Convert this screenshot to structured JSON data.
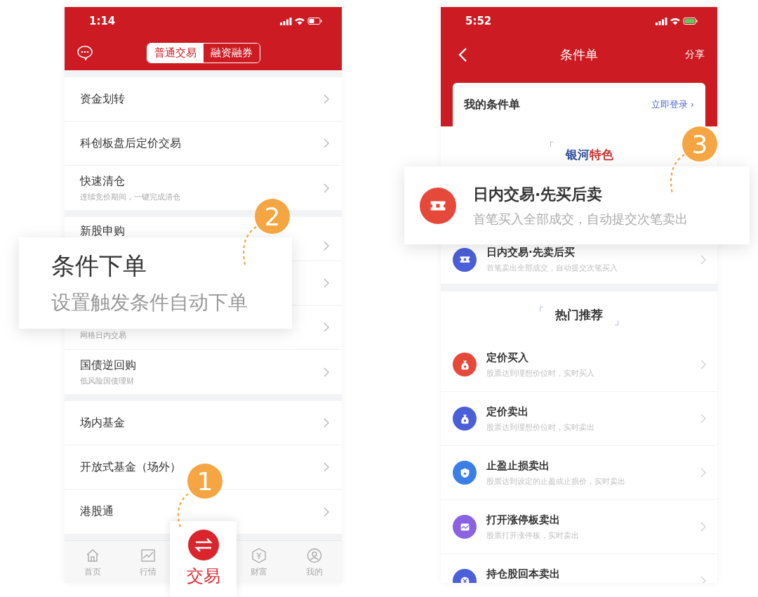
{
  "left_screen": {
    "status_bar": {
      "time": "1:14"
    },
    "segmented_tabs": [
      {
        "label": "普通交易",
        "selected": true
      },
      {
        "label": "融资融券",
        "selected": false
      }
    ],
    "groups": [
      {
        "rows": [
          {
            "title": "资金划转"
          },
          {
            "title": "科创板盘后定价交易"
          },
          {
            "title": "快速清仓",
            "subtitle": "连续竞价期间，一键完成清仓"
          }
        ]
      },
      {
        "rows": [
          {
            "title": "新股申购"
          },
          {},
          {
            "subtitle": "网格日内交易"
          },
          {
            "title": "国债逆回购",
            "subtitle": "低风险国债理财"
          }
        ]
      },
      {
        "rows": [
          {
            "title": "场内基金"
          },
          {
            "title": "开放式基金（场外）"
          },
          {
            "title": "港股通"
          }
        ]
      }
    ],
    "tab_bar": [
      {
        "label": "首页",
        "selected": false
      },
      {
        "label": "行情",
        "selected": false
      },
      {
        "label": "交易",
        "selected": true
      },
      {
        "label": "财富",
        "selected": false
      },
      {
        "label": "我的",
        "selected": false
      }
    ]
  },
  "right_screen": {
    "status_bar": {
      "time": "5:52"
    },
    "nav_title": "条件单",
    "share": "分享",
    "card": {
      "title": "我的条件单",
      "login_link": "立即登录 ›"
    },
    "sections": [
      {
        "open_bracket": "「",
        "title_parts": [
          {
            "text": "银河",
            "color": "#2f4f9e"
          },
          {
            "text": "特色",
            "color": "#c8322e"
          }
        ],
        "rows": [
          {
            "title": "日内交易·先卖后买",
            "subtitle": "首笔卖出全部成交，自动提交次笔买入",
            "color": "#4b5fd8"
          }
        ]
      },
      {
        "open_bracket": "「",
        "close_bracket": "」",
        "title_parts": [
          {
            "text": "热门推荐",
            "color": "#333333"
          }
        ],
        "rows": [
          {
            "title": "定价买入",
            "subtitle": "股票达到理想价位时，实时买入",
            "color": "#e6493a"
          },
          {
            "title": "定价卖出",
            "subtitle": "股票达到理想价位时，实时卖出",
            "color": "#4b5fd8"
          },
          {
            "title": "止盈止损卖出",
            "subtitle": "股票达到设定的止盈或止损价，实时卖出",
            "color": "#3b7fe6"
          },
          {
            "title": "打开涨停板卖出",
            "subtitle": "股票打开涨停板，实时卖出",
            "color": "#8a62e2"
          },
          {
            "title": "持仓股回本卖出",
            "color": "#4b5fd8"
          }
        ]
      }
    ]
  },
  "zoom_cards": [
    {
      "kind": "text",
      "title": "条件下单",
      "subtitle": "设置触发条件自动下单"
    },
    {
      "kind": "icon_row",
      "title": "日内交易·先买后卖",
      "subtitle": "首笔买入全部成交，自动提交次笔卖出",
      "color": "#e6493a"
    }
  ],
  "badges": [
    {
      "number": "1"
    },
    {
      "number": "2"
    },
    {
      "number": "3"
    }
  ]
}
